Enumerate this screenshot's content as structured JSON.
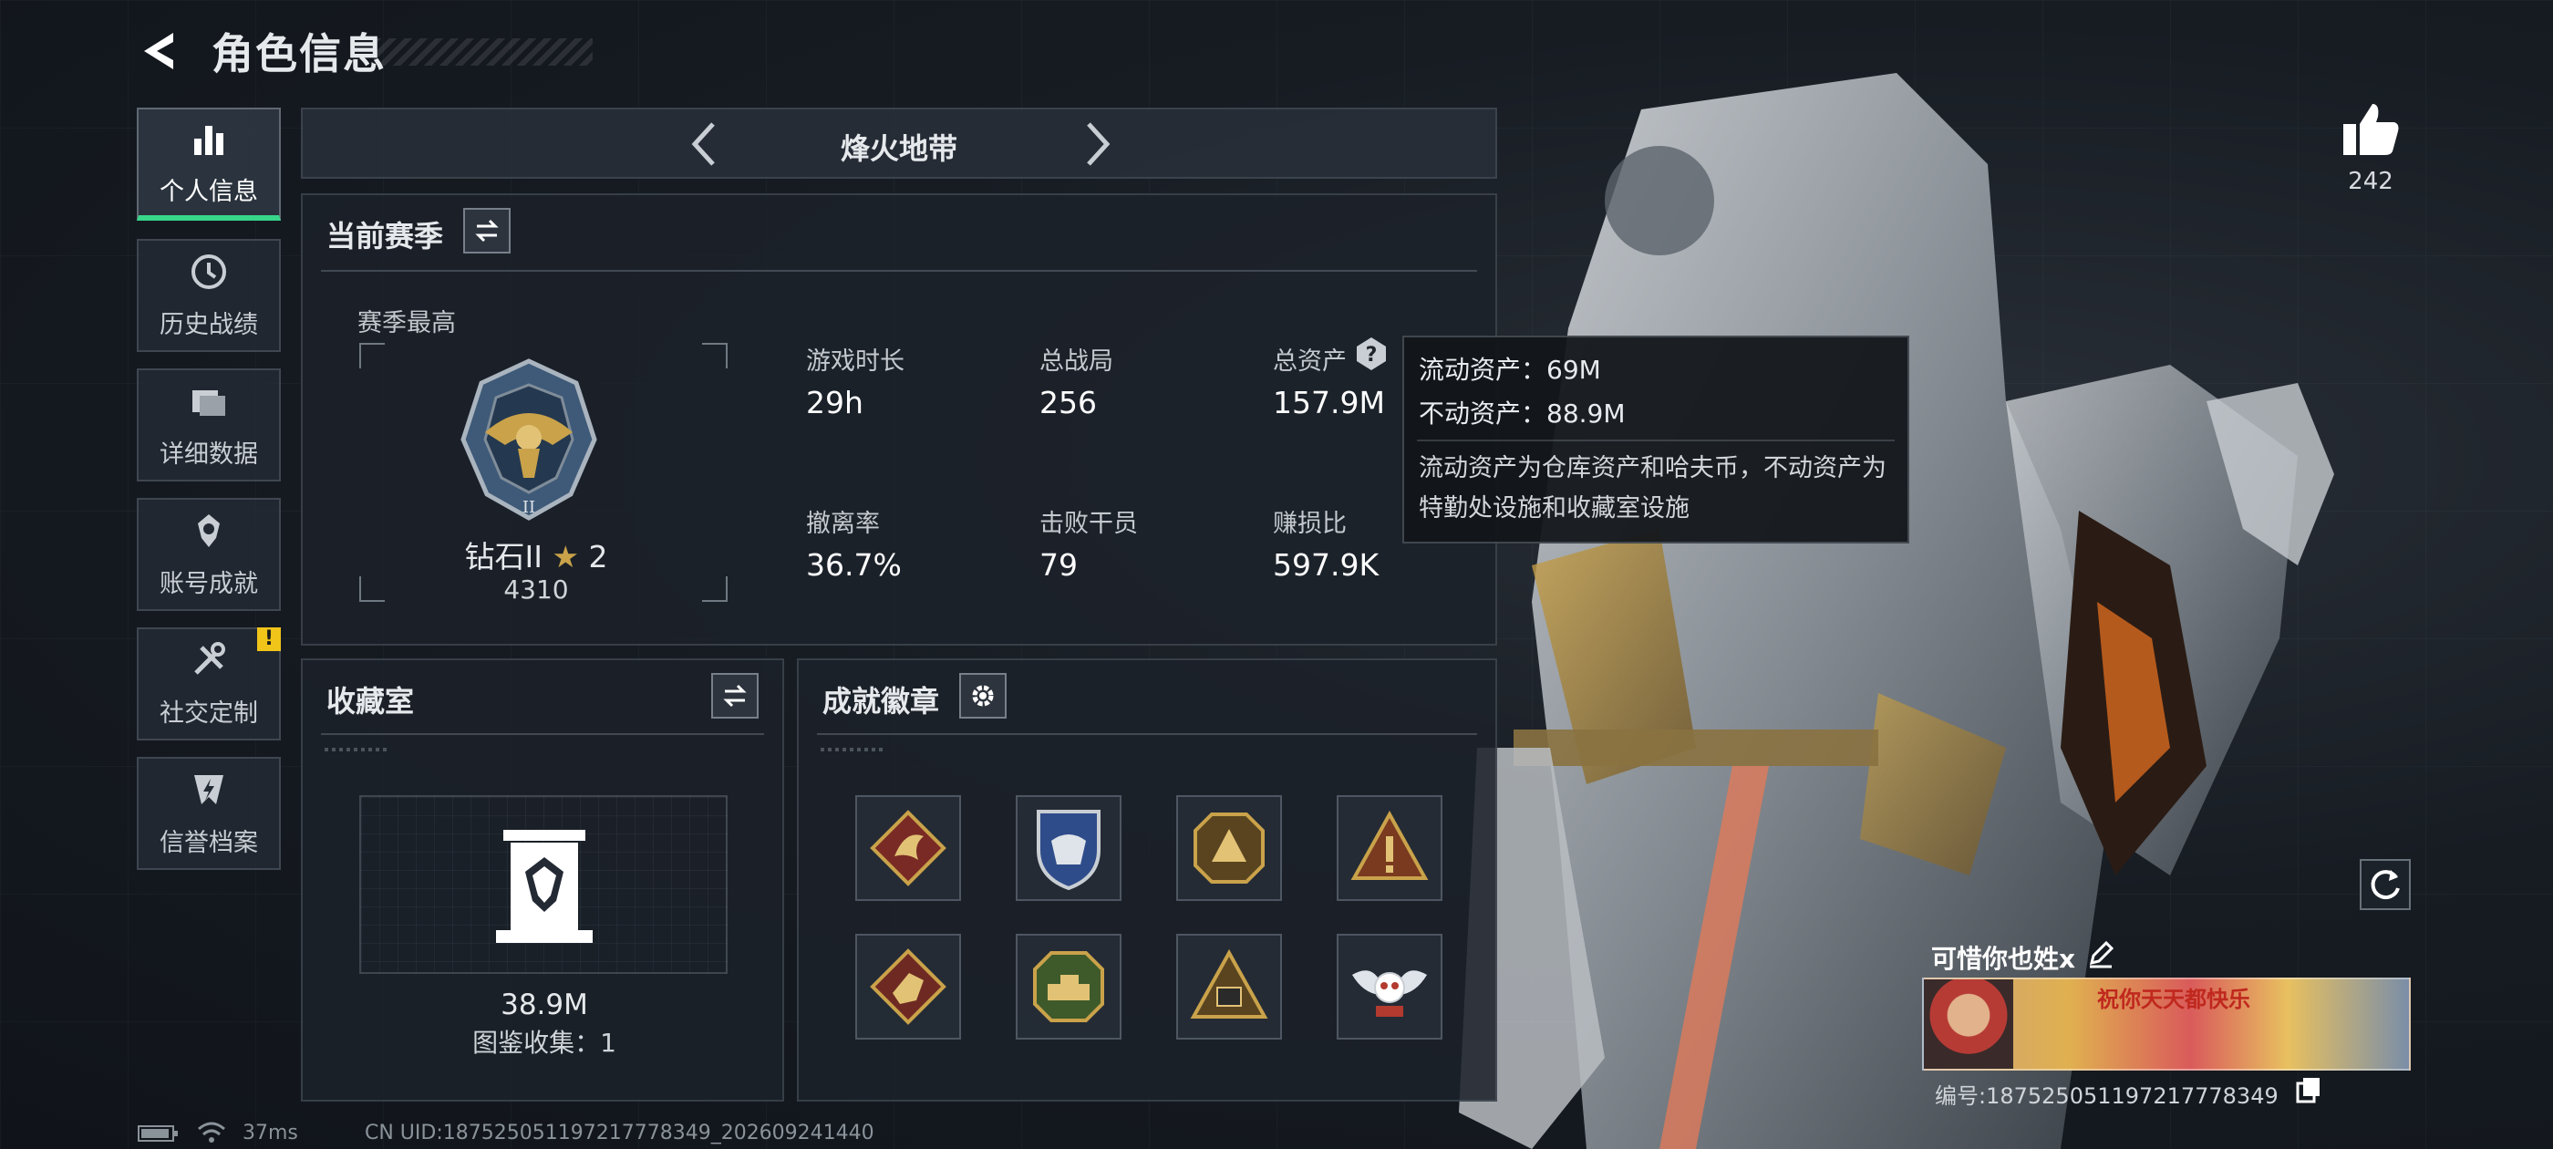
{
  "header": {
    "title": "角色信息"
  },
  "nav": {
    "items": [
      {
        "label": "个人信息"
      },
      {
        "label": "历史战绩"
      },
      {
        "label": "详细数据"
      },
      {
        "label": "账号成就"
      },
      {
        "label": "社交定制",
        "badge": "!"
      },
      {
        "label": "信誉档案"
      }
    ]
  },
  "mode": {
    "title": "烽火地带"
  },
  "season": {
    "title": "当前赛季",
    "highest_label": "赛季最高",
    "rank_name": "钻石II",
    "rank_stars": "2",
    "rank_score": "4310",
    "stats": [
      {
        "label": "游戏时长",
        "value": "29h"
      },
      {
        "label": "总战局",
        "value": "256"
      },
      {
        "label": "总资产",
        "value": "157.9M"
      },
      {
        "label": "撤离率",
        "value": "36.7%"
      },
      {
        "label": "击败干员",
        "value": "79"
      },
      {
        "label": "赚损比",
        "value": "597.9K"
      }
    ]
  },
  "tooltip": {
    "liquid": "流动资产：69M",
    "fixed": "不动资产：88.9M",
    "description": "流动资产为仓库资产和哈夫币，不动资产为特勤处设施和收藏室设施"
  },
  "collection": {
    "title": "收藏室",
    "value": "38.9M",
    "catalog": "图鉴收集：1"
  },
  "achievements": {
    "title": "成就徽章"
  },
  "profile": {
    "likes": "242",
    "name": "可惜你也姓x",
    "id": "编号:1875250511972177783​49",
    "banner_text": "祝你天天都快乐"
  },
  "status_bar": {
    "ping": "37ms",
    "uid": "CN UID:187525051197217778349_202609241440"
  },
  "colors": {
    "accent": "#38d68a",
    "warning": "#f0c419",
    "gold": "#c9a24a"
  }
}
